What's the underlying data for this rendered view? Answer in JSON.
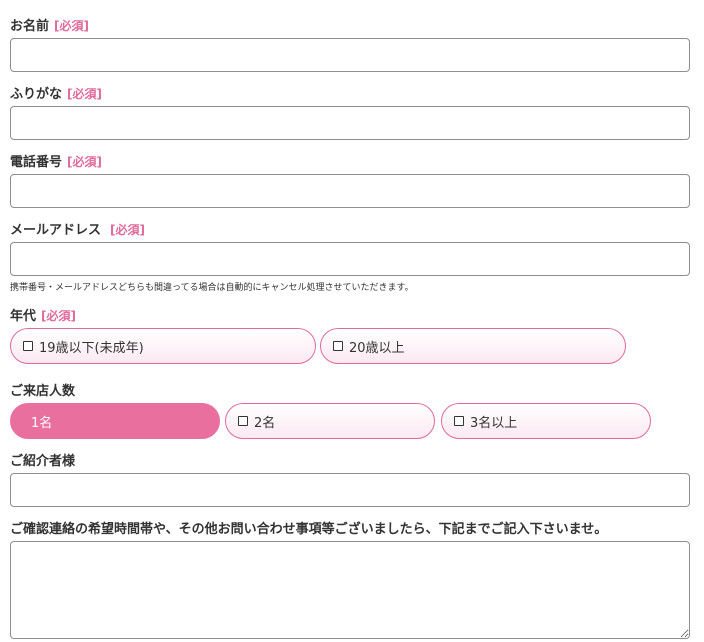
{
  "form": {
    "required_tag": "[必須]",
    "name": {
      "label": "お名前",
      "value": ""
    },
    "furigana": {
      "label": "ふりがな",
      "value": ""
    },
    "phone": {
      "label": "電話番号",
      "value": ""
    },
    "email": {
      "label": "メールアドレス",
      "value": "",
      "note": "携帯番号・メールアドレスどちらも間違ってる場合は自動的にキャンセル処理させていただきます。"
    },
    "age": {
      "label": "年代",
      "options": [
        "19歳以下(未成年)",
        "20歳以上"
      ]
    },
    "guests": {
      "label": "ご来店人数",
      "options": [
        "1名",
        "2名",
        "3名以上"
      ],
      "selected": "1名"
    },
    "referrer": {
      "label": "ご紹介者様",
      "value": ""
    },
    "message": {
      "label": "ご確認連絡の希望時間帯や、その他お問い合わせ事項等ございましたら、下記までご記入下さいませ。",
      "value": ""
    }
  },
  "colors": {
    "accent": "#e9709e",
    "required": "#e06a9c",
    "border": "#8e8e8e"
  }
}
